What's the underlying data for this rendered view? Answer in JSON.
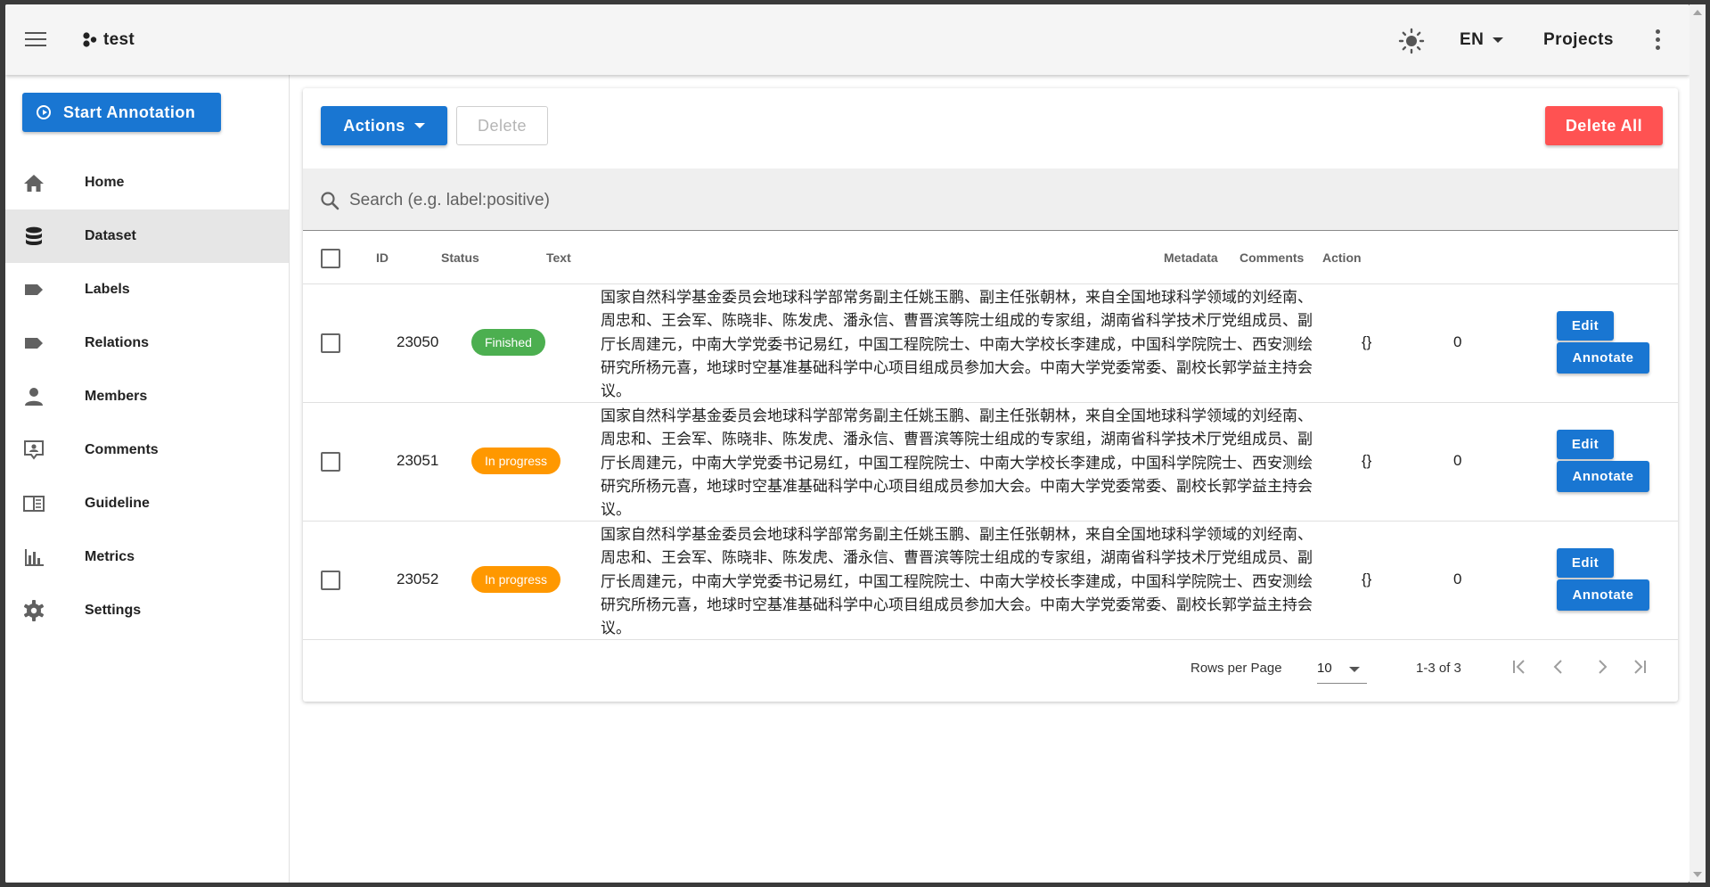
{
  "app": {
    "title": "test"
  },
  "appbar": {
    "language": "EN",
    "projects_label": "Projects"
  },
  "sidebar": {
    "start_label": "Start Annotation",
    "items": [
      {
        "label": "Home",
        "icon": "home-icon"
      },
      {
        "label": "Dataset",
        "icon": "database-icon",
        "active": true
      },
      {
        "label": "Labels",
        "icon": "label-icon"
      },
      {
        "label": "Relations",
        "icon": "label-icon"
      },
      {
        "label": "Members",
        "icon": "account-icon"
      },
      {
        "label": "Comments",
        "icon": "comment-account-icon"
      },
      {
        "label": "Guideline",
        "icon": "book-open-icon"
      },
      {
        "label": "Metrics",
        "icon": "chart-bar-icon"
      },
      {
        "label": "Settings",
        "icon": "cog-icon"
      }
    ]
  },
  "toolbar": {
    "actions_label": "Actions",
    "delete_label": "Delete",
    "delete_all_label": "Delete All"
  },
  "search": {
    "placeholder": "Search (e.g. label:positive)",
    "value": ""
  },
  "table": {
    "headers": {
      "id": "ID",
      "status": "Status",
      "text": "Text",
      "metadata": "Metadata",
      "comments": "Comments",
      "action": "Action"
    },
    "rows": [
      {
        "id": "23050",
        "status": "Finished",
        "text": "国家自然科学基金委员会地球科学部常务副主任姚玉鹏、副主任张朝林，来自全国地球科学领域的刘经南、周忠和、王会军、陈晓非、陈发虎、潘永信、曹晋滨等院士组成的专家组，湖南省科学技术厅党组成员、副厅长周建元，中南大学党委书记易红，中国工程院院士、中南大学校长李建成，中国科学院院士、西安测绘研究所杨元喜，地球时空基准基础科学中心项目组成员参加大会。中南大学党委常委、副校长郭学益主持会议。",
        "metadata": "{}",
        "comments": "0",
        "edit_label": "Edit",
        "annotate_label": "Annotate"
      },
      {
        "id": "23051",
        "status": "In progress",
        "text": "国家自然科学基金委员会地球科学部常务副主任姚玉鹏、副主任张朝林，来自全国地球科学领域的刘经南、周忠和、王会军、陈晓非、陈发虎、潘永信、曹晋滨等院士组成的专家组，湖南省科学技术厅党组成员、副厅长周建元，中南大学党委书记易红，中国工程院院士、中南大学校长李建成，中国科学院院士、西安测绘研究所杨元喜，地球时空基准基础科学中心项目组成员参加大会。中南大学党委常委、副校长郭学益主持会议。",
        "metadata": "{}",
        "comments": "0",
        "edit_label": "Edit",
        "annotate_label": "Annotate"
      },
      {
        "id": "23052",
        "status": "In progress",
        "text": "国家自然科学基金委员会地球科学部常务副主任姚玉鹏、副主任张朝林，来自全国地球科学领域的刘经南、周忠和、王会军、陈晓非、陈发虎、潘永信、曹晋滨等院士组成的专家组，湖南省科学技术厅党组成员、副厅长周建元，中南大学党委书记易红，中国工程院院士、中南大学校长李建成，中国科学院院士、西安测绘研究所杨元喜，地球时空基准基础科学中心项目组成员参加大会。中南大学党委常委、副校长郭学益主持会议。",
        "metadata": "{}",
        "comments": "0",
        "edit_label": "Edit",
        "annotate_label": "Annotate"
      }
    ]
  },
  "pagination": {
    "rows_per_page_label": "Rows per Page",
    "rows_per_page": "10",
    "range": "1-3 of 3"
  },
  "colors": {
    "primary": "#1976d2",
    "danger": "#ff5252",
    "finished": "#4caf50",
    "in_progress": "#ff9800"
  }
}
